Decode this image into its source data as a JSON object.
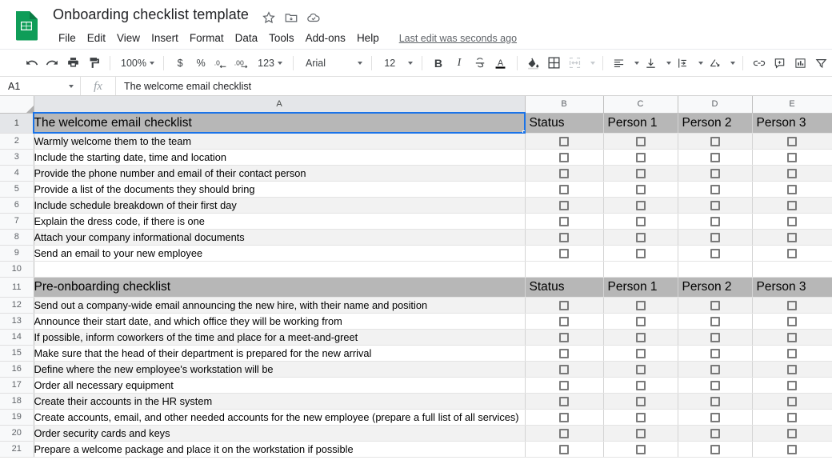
{
  "app": {
    "logo": "sheets-logo",
    "doc_title": "Onboarding checklist template",
    "title_icons": [
      "star-icon",
      "move-to-folder-icon",
      "cloud-saved-icon"
    ],
    "last_edit": "Last edit was seconds ago"
  },
  "menus": [
    "File",
    "Edit",
    "View",
    "Insert",
    "Format",
    "Data",
    "Tools",
    "Add-ons",
    "Help"
  ],
  "toolbar": {
    "undo": "undo-icon",
    "redo": "redo-icon",
    "print": "print-icon",
    "paint_format": "paint-format-icon",
    "zoom_value": "100%",
    "currency": "$",
    "percent": "%",
    "decrease_decimal": ".0",
    "increase_decimal": ".00",
    "more_formats": "123",
    "font_family": "Arial",
    "font_size": "12",
    "bold": "B",
    "italic": "I",
    "strikethrough": "S",
    "text_color": "A",
    "fill_color": "fill-color-icon",
    "borders": "borders-icon",
    "merge_cells": "merge-cells-icon",
    "horizontal_align": "horizontal-align-icon",
    "vertical_align": "vertical-align-icon",
    "text_wrap": "text-wrapping-icon",
    "text_rotation": "text-rotation-icon",
    "insert_link": "insert-link-icon",
    "insert_comment": "insert-comment-icon",
    "insert_chart": "insert-chart-icon",
    "filter": "filter-icon"
  },
  "formula_bar": {
    "name_box": "A1",
    "fx": "fx",
    "value": "The welcome email checklist"
  },
  "grid": {
    "columns": [
      "A",
      "B",
      "C",
      "D",
      "E"
    ],
    "selected_column": "A",
    "selected_cell": "A1",
    "rows": [
      {
        "n": "1",
        "type": "section",
        "a": "The welcome email checklist",
        "b": "Status",
        "c": "Person 1",
        "d": "Person 2",
        "e": "Person 3"
      },
      {
        "n": "2",
        "type": "item",
        "a": "Warmly welcome them to the team"
      },
      {
        "n": "3",
        "type": "item",
        "a": "Include the starting date, time and location"
      },
      {
        "n": "4",
        "type": "item",
        "a": "Provide the phone number and email of their contact person"
      },
      {
        "n": "5",
        "type": "item",
        "a": "Provide a list of the documents they should bring"
      },
      {
        "n": "6",
        "type": "item",
        "a": "Include schedule breakdown of their first day"
      },
      {
        "n": "7",
        "type": "item",
        "a": "Explain the dress code, if there is one"
      },
      {
        "n": "8",
        "type": "item",
        "a": "Attach your company informational documents"
      },
      {
        "n": "9",
        "type": "item",
        "a": "Send an email to your new employee"
      },
      {
        "n": "10",
        "type": "blank",
        "a": ""
      },
      {
        "n": "11",
        "type": "section",
        "a": "Pre-onboarding checklist",
        "b": "Status",
        "c": "Person 1",
        "d": "Person 2",
        "e": "Person 3"
      },
      {
        "n": "12",
        "type": "item",
        "a": "Send out a company-wide email announcing the new hire, with their name and position"
      },
      {
        "n": "13",
        "type": "item",
        "a": "Announce their start date, and which office they will be working from"
      },
      {
        "n": "14",
        "type": "item",
        "a": "If possible, inform coworkers of the time and place for a meet-and-greet"
      },
      {
        "n": "15",
        "type": "item",
        "a": "Make sure that the head of their department is prepared for the new arrival"
      },
      {
        "n": "16",
        "type": "item",
        "a": "Define where the new employee's workstation will be"
      },
      {
        "n": "17",
        "type": "item",
        "a": "Order all necessary equipment"
      },
      {
        "n": "18",
        "type": "item",
        "a": "Create their accounts in the HR system"
      },
      {
        "n": "19",
        "type": "item",
        "a": "Create accounts, email, and other needed accounts for the new employee (prepare a full list of all services)"
      },
      {
        "n": "20",
        "type": "item",
        "a": "Order security cards and keys"
      },
      {
        "n": "21",
        "type": "item",
        "a": "Prepare a welcome package and place it on the workstation if possible"
      }
    ]
  },
  "colors": {
    "brand_green": "#0f9d58",
    "selection_blue": "#1a73e8",
    "section_gray": "#b7b7b7",
    "band_gray": "#f2f2f2",
    "header_gray": "#f8f9fa"
  }
}
